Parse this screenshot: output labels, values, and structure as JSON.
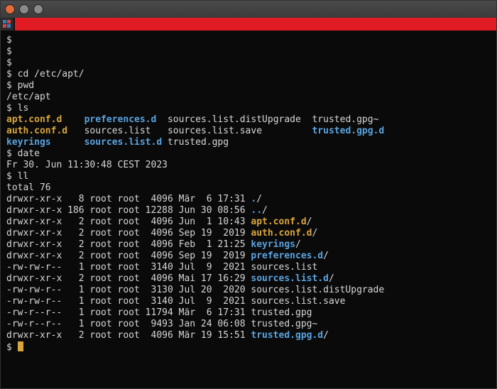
{
  "prompt": "$",
  "commands": {
    "cd": "cd /etc/apt/",
    "pwd": "pwd",
    "pwd_out": "/etc/apt",
    "ls": "ls",
    "date": "date",
    "date_out": "Fr 30. Jun 11:30:48 CEST 2023",
    "ll": "ll",
    "ll_total": "total 76"
  },
  "ls_out": {
    "r1c1": "apt.conf.d",
    "r1c2": "preferences.d",
    "r1c3": "sources.list.distUpgrade",
    "r1c4": "trusted.gpg~",
    "r2c1": "auth.conf.d",
    "r2c2": "sources.list",
    "r2c3": "sources.list.save",
    "r2c4": "trusted.gpg.d",
    "r3c1": "keyrings",
    "r3c2": "sources.list.d",
    "r3c3": "trusted.gpg"
  },
  "ll": [
    {
      "perm": "drwxr-xr-x",
      "n": "  8",
      "own": "root root",
      "size": " 4096",
      "mtime": "Mär  6 17:31",
      "name": ".",
      "slash": "/",
      "cls": "dir"
    },
    {
      "perm": "drwxr-xr-x",
      "n": "186",
      "own": "root root",
      "size": "12288",
      "mtime": "Jun 30 08:56",
      "name": "..",
      "slash": "/",
      "cls": "dir"
    },
    {
      "perm": "drwxr-xr-x",
      "n": "  2",
      "own": "root root",
      "size": " 4096",
      "mtime": "Jun  1 10:43",
      "name": "apt.conf.d",
      "slash": "/",
      "cls": "yel"
    },
    {
      "perm": "drwxr-xr-x",
      "n": "  2",
      "own": "root root",
      "size": " 4096",
      "mtime": "Sep 19  2019",
      "name": "auth.conf.d",
      "slash": "/",
      "cls": "yel"
    },
    {
      "perm": "drwxr-xr-x",
      "n": "  2",
      "own": "root root",
      "size": " 4096",
      "mtime": "Feb  1 21:25",
      "name": "keyrings",
      "slash": "/",
      "cls": "dir"
    },
    {
      "perm": "drwxr-xr-x",
      "n": "  2",
      "own": "root root",
      "size": " 4096",
      "mtime": "Sep 19  2019",
      "name": "preferences.d",
      "slash": "/",
      "cls": "dir"
    },
    {
      "perm": "-rw-rw-r--",
      "n": "  1",
      "own": "root root",
      "size": " 3140",
      "mtime": "Jul  9  2021",
      "name": "sources.list",
      "slash": "",
      "cls": "out"
    },
    {
      "perm": "drwxr-xr-x",
      "n": "  2",
      "own": "root root",
      "size": " 4096",
      "mtime": "Mai 17 16:29",
      "name": "sources.list.d",
      "slash": "/",
      "cls": "dir"
    },
    {
      "perm": "-rw-rw-r--",
      "n": "  1",
      "own": "root root",
      "size": " 3130",
      "mtime": "Jul 20  2020",
      "name": "sources.list.distUpgrade",
      "slash": "",
      "cls": "out"
    },
    {
      "perm": "-rw-rw-r--",
      "n": "  1",
      "own": "root root",
      "size": " 3140",
      "mtime": "Jul  9  2021",
      "name": "sources.list.save",
      "slash": "",
      "cls": "out"
    },
    {
      "perm": "-rw-r--r--",
      "n": "  1",
      "own": "root root",
      "size": "11794",
      "mtime": "Mär  6 17:31",
      "name": "trusted.gpg",
      "slash": "",
      "cls": "out"
    },
    {
      "perm": "-rw-r--r--",
      "n": "  1",
      "own": "root root",
      "size": " 9493",
      "mtime": "Jan 24 06:08",
      "name": "trusted.gpg~",
      "slash": "",
      "cls": "out"
    },
    {
      "perm": "drwxr-xr-x",
      "n": "  2",
      "own": "root root",
      "size": " 4096",
      "mtime": "Mär 19 15:51",
      "name": "trusted.gpg.d",
      "slash": "/",
      "cls": "dir"
    }
  ]
}
